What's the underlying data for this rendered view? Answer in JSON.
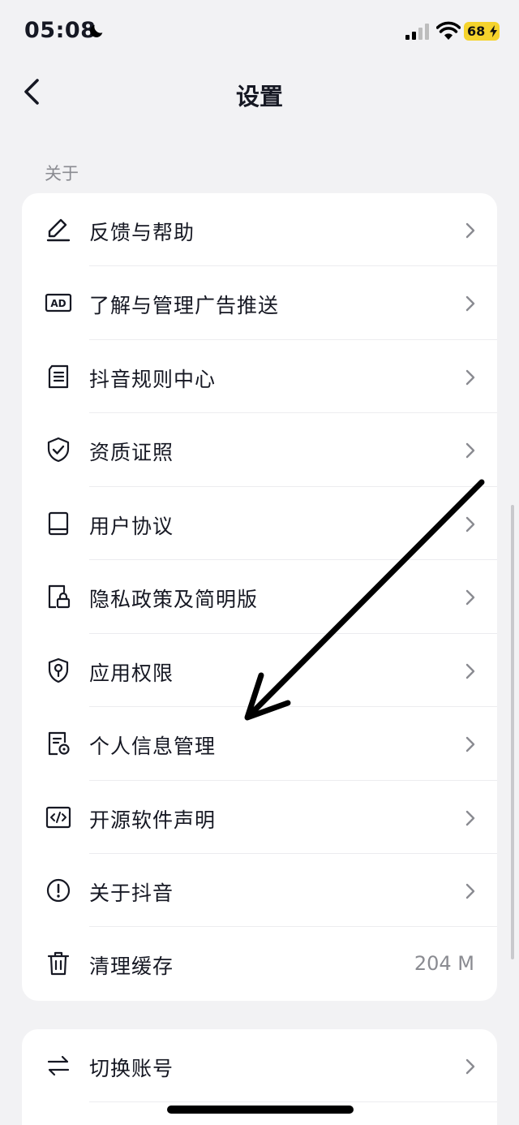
{
  "status_bar": {
    "time": "05:08",
    "battery": "68"
  },
  "nav": {
    "title": "设置"
  },
  "about_section": {
    "label": "关于",
    "items": [
      {
        "label": "反馈与帮助",
        "icon": "pencil-icon"
      },
      {
        "label": "了解与管理广告推送",
        "icon": "ad-icon"
      },
      {
        "label": "抖音规则中心",
        "icon": "document-list-icon"
      },
      {
        "label": "资质证照",
        "icon": "shield-check-icon"
      },
      {
        "label": "用户协议",
        "icon": "book-icon"
      },
      {
        "label": "隐私政策及简明版",
        "icon": "privacy-lock-icon"
      },
      {
        "label": "应用权限",
        "icon": "location-shield-icon"
      },
      {
        "label": "个人信息管理",
        "icon": "document-gear-icon"
      },
      {
        "label": "开源软件声明",
        "icon": "code-icon"
      },
      {
        "label": "关于抖音",
        "icon": "info-circle-icon"
      },
      {
        "label": "清理缓存",
        "icon": "trash-icon",
        "value": "204 M"
      }
    ]
  },
  "account_section": {
    "items": [
      {
        "label": "切换账号",
        "icon": "switch-arrows-icon"
      }
    ]
  },
  "colors": {
    "background": "#f2f2f4",
    "card": "#ffffff",
    "text": "#161823",
    "secondary_text": "#8a8b91",
    "battery": "#f5d32c"
  }
}
